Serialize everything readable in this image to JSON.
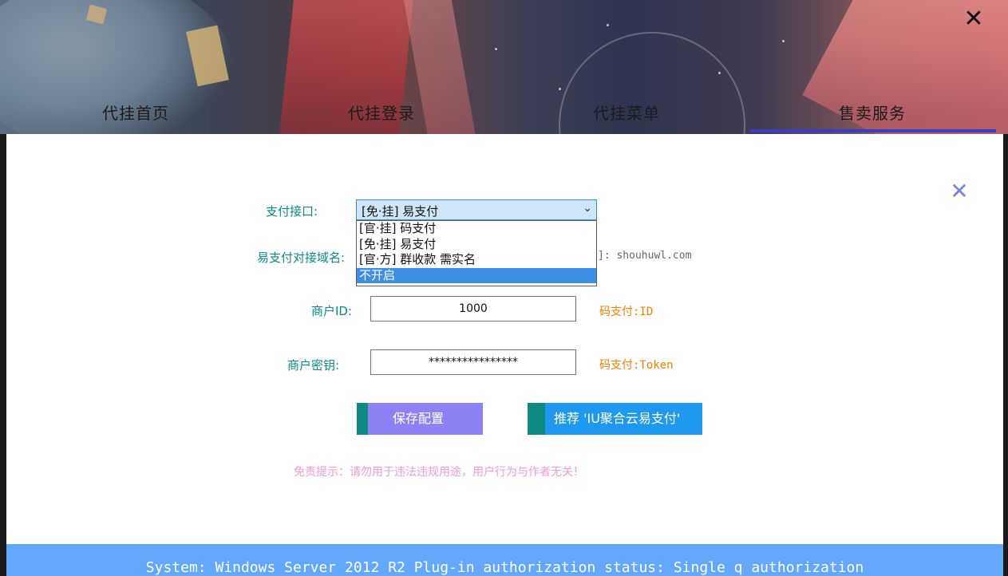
{
  "window": {
    "close_icon": "close-icon"
  },
  "nav": {
    "items": [
      {
        "label": "代挂首页"
      },
      {
        "label": "代挂登录"
      },
      {
        "label": "代挂菜单"
      },
      {
        "label": "售卖服务"
      }
    ],
    "active_index": 3
  },
  "form": {
    "payment_interface": {
      "label": "支付接口:",
      "selected": "[免·挂] 易支付",
      "options": [
        "[官·挂] 码支付",
        "[免·挂] 易支付",
        "[官·方] 群收款 需实名",
        "不开启"
      ],
      "highlighted_option": "不开启"
    },
    "domain": {
      "label": "易支付对接域名:",
      "hint": "]: shouhuwl.com"
    },
    "merchant_id": {
      "label": "商户ID:",
      "value": "1000",
      "hint": "码支付:ID"
    },
    "merchant_key": {
      "label": "商户密钥:",
      "value": "****************",
      "hint": "码支付:Token"
    },
    "save_label": "保存配置",
    "recommend_label": "推荐 'IU聚合云易支付'",
    "disclaimer": "免责提示：请勿用于违法违规用途，用户行为与作者无关！"
  },
  "status_bar": {
    "text": "System:  Windows Server 2012 R2  Plug-in authorization status:  Single q authorization"
  },
  "colors": {
    "accent_teal": "#0a8a8a",
    "hint_orange": "#f08000",
    "save_button": "#8c82f6",
    "recommend_button": "#1f99ef",
    "status_bar": "#63a8fa",
    "disclaimer_pink": "#f29ad4"
  }
}
